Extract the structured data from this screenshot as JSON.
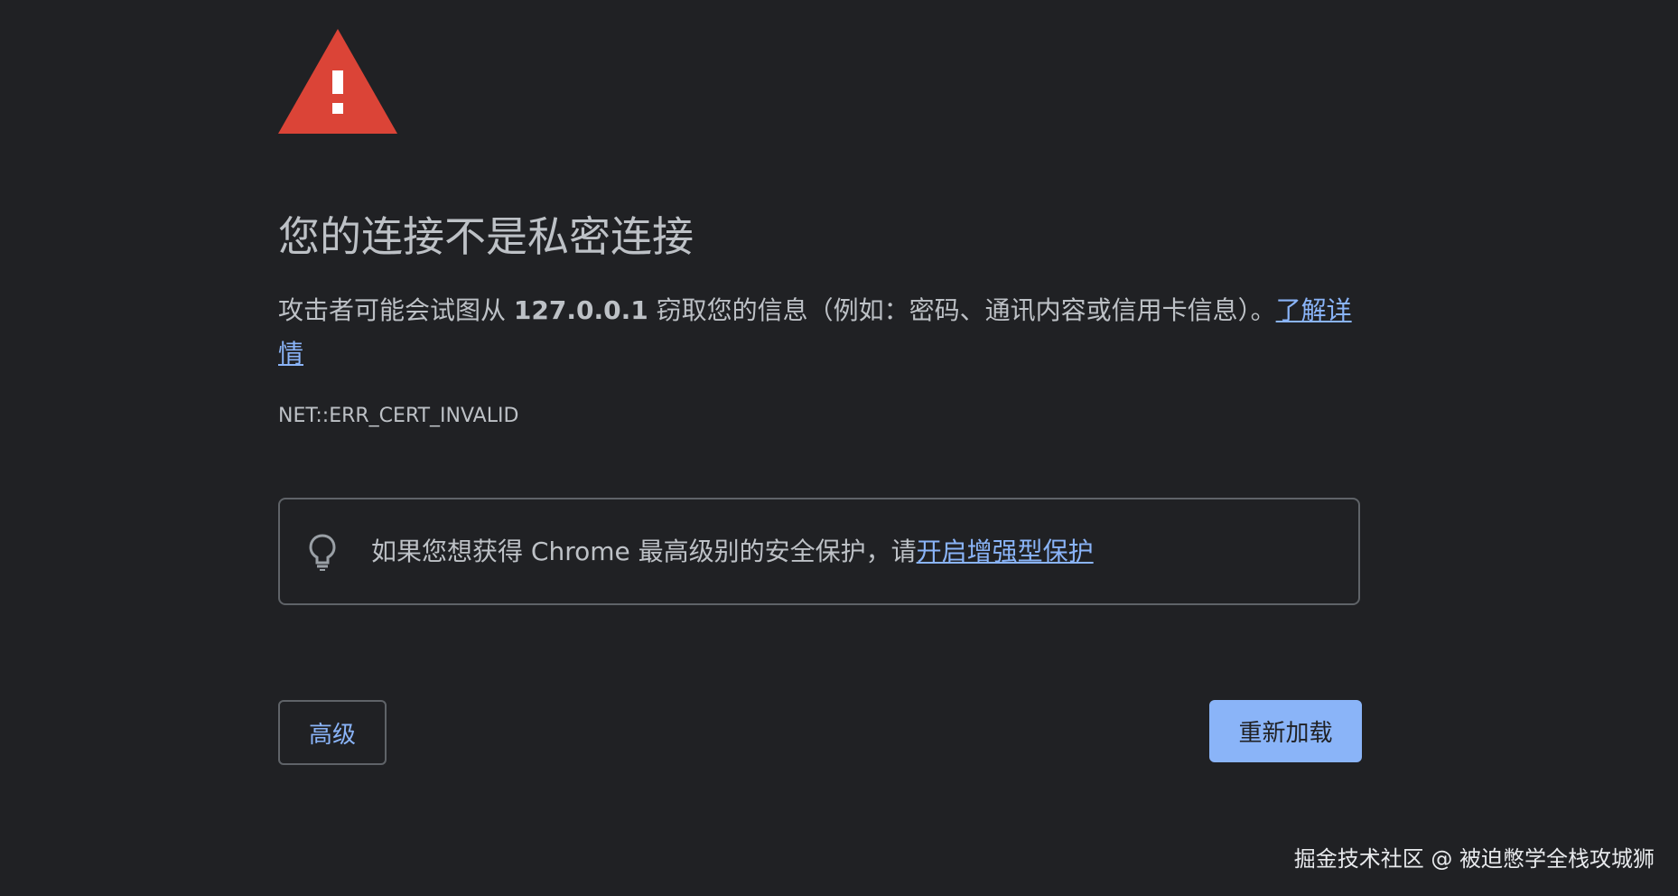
{
  "interstitial": {
    "headline": "您的连接不是私密连接",
    "explanation_prefix": "攻击者可能会试图从 ",
    "host": "127.0.0.1",
    "explanation_suffix": " 窃取您的信息（例如：密码、通讯内容或信用卡信息）。",
    "learn_more_link": "了解详情",
    "error_code": "NET::ERR_CERT_INVALID",
    "warning_icon_color": "#db4437"
  },
  "enhanced_protection": {
    "text": "如果您想获得 Chrome 最高级别的安全保护，请",
    "link": "开启增强型保护",
    "icon": "lightbulb-icon"
  },
  "buttons": {
    "advanced_label": "高级",
    "reload_label": "重新加载",
    "primary_color": "#8ab4f8"
  },
  "watermark": {
    "text": "掘金技术社区 @ 被迫憋学全栈攻城狮"
  }
}
